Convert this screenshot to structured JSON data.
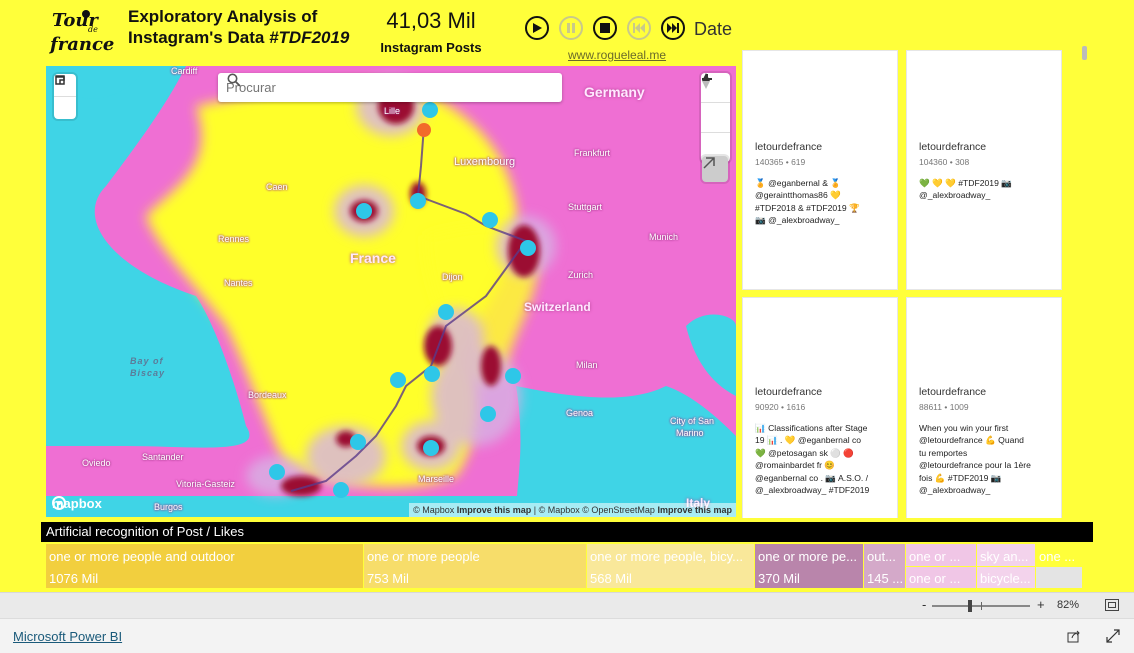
{
  "header": {
    "title_line1": "Exploratory Analysis of",
    "title_line2_prefix": "Instagram's Data",
    "title_line2_hashtag": "#TDF2019",
    "kpi_value": "41,03 Mil",
    "kpi_label": "Instagram Posts",
    "play_axis_label": "Date",
    "site_link": "www.rogueleal.me"
  },
  "map": {
    "search_placeholder": "Procurar",
    "labels": {
      "germany": "Germany",
      "france": "France",
      "switzerland": "Switzerland",
      "luxembourg": "Luxembourg",
      "italy": "Italy",
      "cardiff": "Cardiff",
      "lille": "Lille",
      "frankfurt": "Frankfurt",
      "stuttgart": "Stuttgart",
      "munich": "Munich",
      "caen": "Caen",
      "rennes": "Rennes",
      "nantes": "Nantes",
      "dijon": "Dijon",
      "zurich": "Zurich",
      "milan": "Milan",
      "genoa": "Genoa",
      "bordeaux": "Bordeaux",
      "marseille": "Marseille",
      "city_san_marino": "City of San",
      "city_san_marino2": "Marino",
      "santander": "Santander",
      "oviedo": "Oviedo",
      "vitoria": "Vitoria-Gasteiz",
      "burgos": "Burgos",
      "bay1": "Bay of",
      "bay2": "Biscay"
    },
    "attribution_1": "© Mapbox",
    "attribution_improve1": "Improve this map",
    "attribution_2": "| © Mapbox © OpenStreetMap",
    "attribution_improve2": "Improve this map",
    "logo_text": "mapbox"
  },
  "posts": [
    {
      "user": "letourdefrance",
      "stats": "140365 • 619",
      "caption": "🏅 @eganbernal & 🏅\n@geraintthomas86 💛\n#TDF2018 & #TDF2019 🏆\n📷 @_alexbroadway_"
    },
    {
      "user": "letourdefrance",
      "stats": "104360 • 308",
      "caption": "💚 💛 💛 #TDF2019 📷\n@_alexbroadway_"
    },
    {
      "user": "letourdefrance",
      "stats": "90920 • 1616",
      "caption": "📊 Classifications after Stage\n19 📊 . 💛 @eganbernal co\n💚 @petosagan sk ⚪ 🔴\n@romainbardet fr 😊\n@eganbernal co . 📷 A.S.O. /\n@_alexbroadway_ #TDF2019"
    },
    {
      "user": "letourdefrance",
      "stats": "88611 • 1009",
      "caption": "When you win your first\n@letourdefrance 💪 Quand\ntu remportes\n@letourdefrance pour la 1ère\nfois 💪 #TDF2019 📷\n@_alexbroadway_"
    }
  ],
  "treemap": {
    "title": "Artificial recognition of Post / Likes",
    "cells": [
      {
        "category": "one or more people and outdoor",
        "value": "1076 Mil",
        "color": "#f2cf3e"
      },
      {
        "category": "one or more people",
        "value": "753 Mil",
        "color": "#f7dd6a"
      },
      {
        "category": "one or more people, bicy...",
        "value": "568 Mil",
        "color": "#f9e89a"
      },
      {
        "category": "one or more pe...",
        "value": "370 Mil",
        "color": "#b985ab"
      },
      {
        "category": "out...",
        "value": "145 ...",
        "color": "#d4a9c9"
      },
      {
        "category": "one or ...",
        "value": "one or ...",
        "color": "#f0c6e6"
      },
      {
        "category": "sky an...",
        "value": "bicycle...",
        "color": "#f3d3ec"
      },
      {
        "category": "one ...",
        "value": "",
        "color": "#d0d0d0"
      }
    ]
  },
  "zoom": {
    "level": "82%",
    "minus": "-",
    "plus": "+"
  },
  "footer": {
    "brand": "Microsoft Power BI"
  }
}
